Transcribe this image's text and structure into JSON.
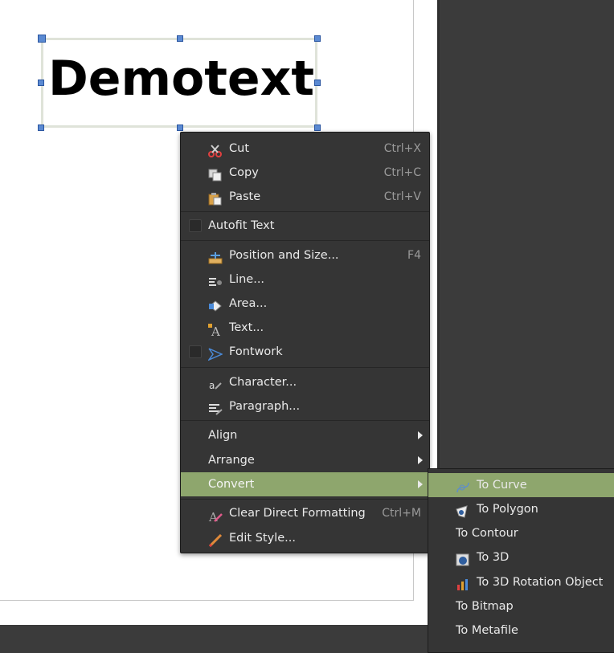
{
  "document": {
    "text": "Demotext"
  },
  "context_menu": {
    "items": [
      {
        "label": "Cut",
        "shortcut": "Ctrl+X",
        "icon": "scissors-icon"
      },
      {
        "label": "Copy",
        "shortcut": "Ctrl+C",
        "icon": "copy-icon"
      },
      {
        "label": "Paste",
        "shortcut": "Ctrl+V",
        "icon": "paste-icon"
      },
      {
        "label": "Autofit Text"
      },
      {
        "label": "Position and Size...",
        "shortcut": "F4",
        "icon": "position-size-icon"
      },
      {
        "label": "Line...",
        "icon": "line-icon"
      },
      {
        "label": "Area...",
        "icon": "area-icon"
      },
      {
        "label": "Text...",
        "icon": "text-attributes-icon"
      },
      {
        "label": "Fontwork",
        "icon": "fontwork-icon"
      },
      {
        "label": "Character...",
        "icon": "character-icon"
      },
      {
        "label": "Paragraph...",
        "icon": "paragraph-icon"
      },
      {
        "label": "Align"
      },
      {
        "label": "Arrange"
      },
      {
        "label": "Convert"
      },
      {
        "label": "Clear Direct Formatting",
        "shortcut": "Ctrl+M",
        "icon": "clear-formatting-icon"
      },
      {
        "label": "Edit Style...",
        "icon": "edit-style-icon"
      }
    ]
  },
  "convert_submenu": {
    "items": [
      {
        "label": "To Curve",
        "icon": "to-curve-icon"
      },
      {
        "label": "To Polygon",
        "icon": "to-polygon-icon"
      },
      {
        "label": "To Contour"
      },
      {
        "label": "To 3D",
        "icon": "to-3d-icon"
      },
      {
        "label": "To 3D Rotation Object",
        "icon": "to-3d-rotation-icon"
      },
      {
        "label": "To Bitmap"
      },
      {
        "label": "To Metafile"
      }
    ]
  },
  "colors": {
    "highlight": "#8ea66d",
    "menu_bg": "#353535",
    "app_bg": "#3b3b3b"
  }
}
